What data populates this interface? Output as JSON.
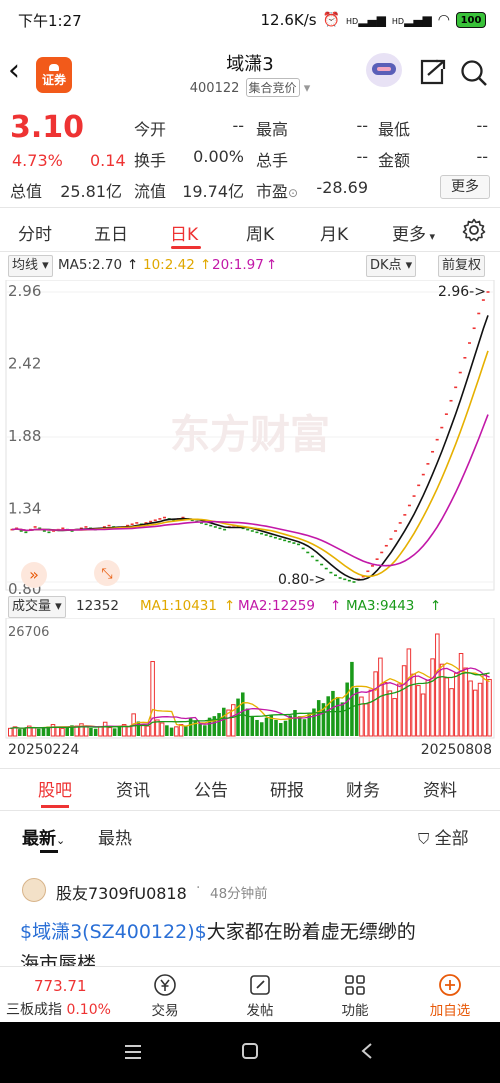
{
  "status": {
    "time": "下午1:27",
    "net_speed": "12.6K/s",
    "battery": "100",
    "hd1": "HD",
    "hd2": "HD"
  },
  "header": {
    "name": "域潇3",
    "code": "400122",
    "market_tag": "集合竞价",
    "logo_text": "证券"
  },
  "quote": {
    "price": "3.10",
    "change_pct": "4.73%",
    "change_abs": "0.14",
    "labels": {
      "open": "今开",
      "high": "最高",
      "low": "最低",
      "turnover": "换手",
      "volume": "总手",
      "amount": "金额",
      "mktcap": "总值",
      "float_cap": "流值",
      "pe": "市盈"
    },
    "values": {
      "open": "--",
      "high": "--",
      "low": "--",
      "turnover": "0.00%",
      "volume": "--",
      "amount": "--",
      "mktcap": "25.81亿",
      "float_cap": "19.74亿",
      "pe": "-28.69"
    },
    "more": "更多"
  },
  "period_tabs": [
    "分时",
    "五日",
    "日K",
    "周K",
    "月K",
    "更多"
  ],
  "indicators": {
    "ma_select": "均线",
    "ma5": "MA5:2.70",
    "ma10": "10:2.42",
    "ma20": "20:1.97",
    "dk": "DK点",
    "adjust": "前复权"
  },
  "chart_data": {
    "type": "candlestick",
    "y_ticks": [
      "2.96",
      "2.42",
      "1.88",
      "1.34",
      "0.80"
    ],
    "ylim": [
      0.8,
      2.96
    ],
    "x_start": "20250224",
    "x_end": "20250808",
    "max_label": "2.96",
    "min_label": "0.80",
    "watermark": "东方财富",
    "close": [
      1.19,
      1.2,
      1.18,
      1.17,
      1.19,
      1.21,
      1.2,
      1.18,
      1.17,
      1.18,
      1.19,
      1.2,
      1.19,
      1.18,
      1.19,
      1.2,
      1.21,
      1.2,
      1.19,
      1.2,
      1.21,
      1.22,
      1.21,
      1.2,
      1.21,
      1.22,
      1.23,
      1.24,
      1.23,
      1.24,
      1.25,
      1.26,
      1.27,
      1.28,
      1.27,
      1.26,
      1.27,
      1.28,
      1.27,
      1.26,
      1.25,
      1.24,
      1.23,
      1.22,
      1.21,
      1.2,
      1.19,
      1.21,
      1.22,
      1.21,
      1.2,
      1.19,
      1.18,
      1.17,
      1.16,
      1.15,
      1.14,
      1.13,
      1.12,
      1.11,
      1.1,
      1.09,
      1.08,
      1.05,
      1.02,
      0.99,
      0.96,
      0.93,
      0.9,
      0.87,
      0.85,
      0.83,
      0.82,
      0.81,
      0.8,
      0.82,
      0.84,
      0.88,
      0.92,
      0.97,
      1.02,
      1.07,
      1.12,
      1.18,
      1.24,
      1.3,
      1.37,
      1.44,
      1.52,
      1.6,
      1.68,
      1.77,
      1.86,
      1.95,
      2.05,
      2.15,
      2.25,
      2.36,
      2.47,
      2.58,
      2.69,
      2.8,
      2.9,
      2.96
    ]
  },
  "volume": {
    "label": "成交量",
    "value": "12352",
    "ma1": "MA1:10431",
    "ma2": "MA2:12259",
    "ma3": "MA3:9443",
    "max_tick": "26706",
    "values": [
      2000,
      2400,
      1800,
      2200,
      2600,
      2100,
      1900,
      2300,
      2500,
      3000,
      2200,
      2000,
      2400,
      2800,
      2600,
      3200,
      2400,
      2100,
      1900,
      2500,
      3600,
      2200,
      2000,
      2600,
      3000,
      2400,
      5800,
      3800,
      3000,
      2600,
      19500,
      4200,
      3400,
      2800,
      2200,
      2400,
      3000,
      2600,
      4600,
      3800,
      3200,
      2800,
      4800,
      5200,
      6000,
      7400,
      6800,
      8200,
      9800,
      11400,
      7200,
      5000,
      4200,
      3600,
      4800,
      5600,
      4200,
      3400,
      4000,
      5400,
      6800,
      5200,
      4400,
      5800,
      7200,
      9400,
      8600,
      10400,
      11800,
      10200,
      8800,
      14000,
      19400,
      12600,
      10200,
      8400,
      12000,
      16800,
      20400,
      14000,
      11800,
      9800,
      13600,
      18400,
      22800,
      16200,
      13200,
      11000,
      14600,
      20200,
      26706,
      18800,
      15200,
      12400,
      16400,
      21600,
      17800,
      14400,
      12000,
      13800,
      16200,
      14800
    ]
  },
  "content_tabs": [
    "股吧",
    "资讯",
    "公告",
    "研报",
    "财务",
    "资料"
  ],
  "sort": {
    "latest": "最新",
    "hot": "最热",
    "filter": "全部"
  },
  "post": {
    "user": "股友7309fU0818",
    "time": "48分钟前",
    "link": "$域潇3(SZ400122)$",
    "text": "大家都在盼着虚无缥缈的",
    "text2": "海市蜃楼"
  },
  "bottom": {
    "index_value": "773.71",
    "index_name": "三板成指",
    "index_change": "0.10%",
    "trade": "交易",
    "post": "发帖",
    "func": "功能",
    "add": "加自选"
  }
}
